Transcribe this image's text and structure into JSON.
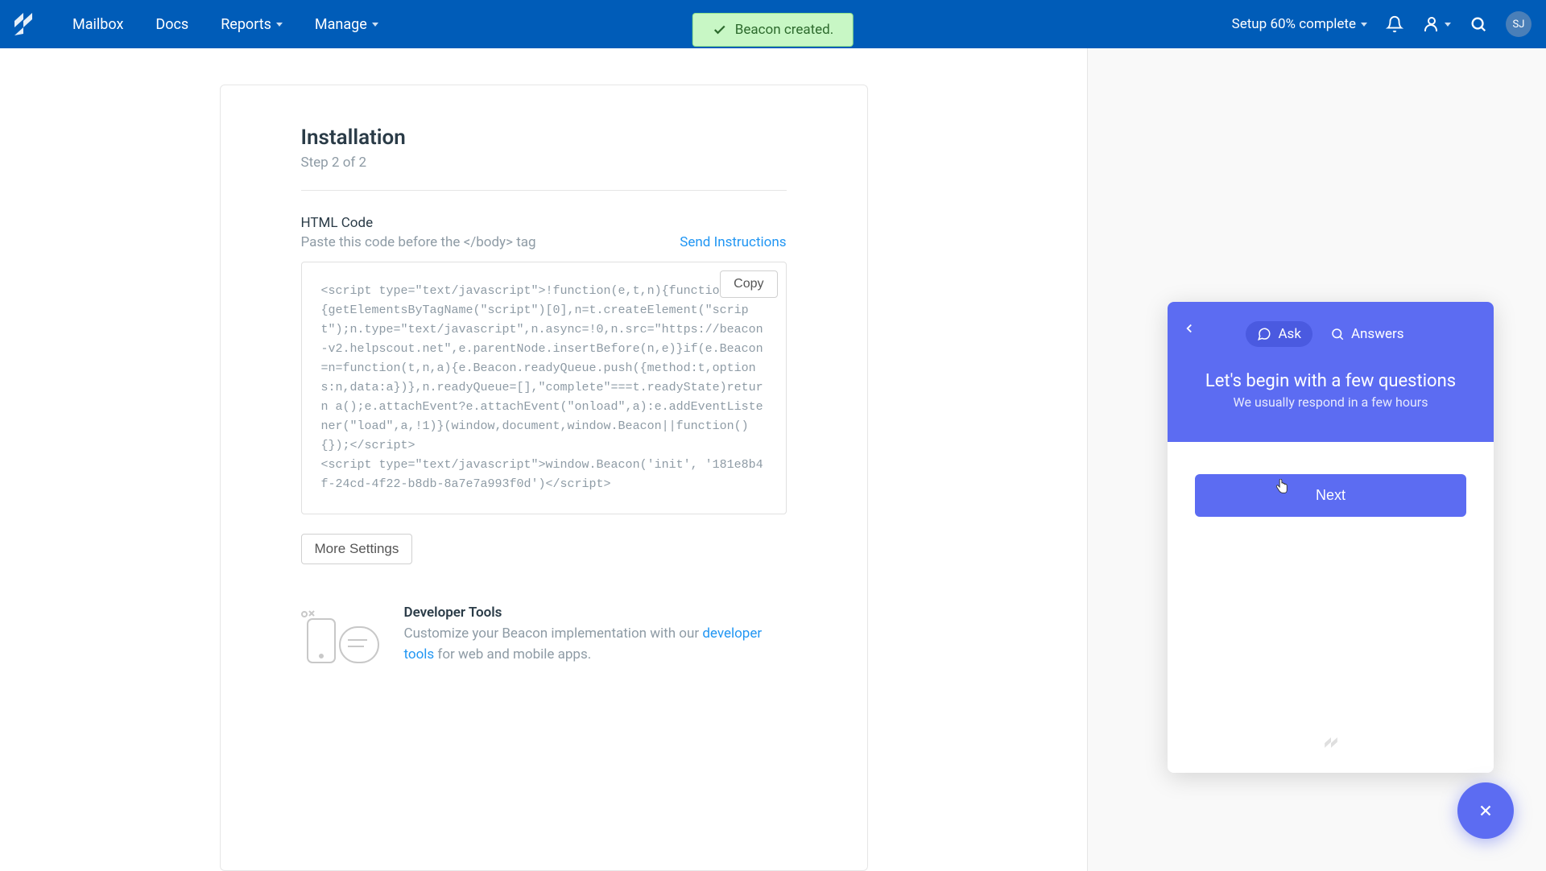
{
  "nav": {
    "items": [
      {
        "label": "Mailbox",
        "has_caret": false
      },
      {
        "label": "Docs",
        "has_caret": false
      },
      {
        "label": "Reports",
        "has_caret": true
      },
      {
        "label": "Manage",
        "has_caret": true
      }
    ],
    "setup_text": "Setup 60% complete",
    "avatar_initials": "SJ"
  },
  "toast": {
    "message": "Beacon created."
  },
  "card": {
    "title": "Installation",
    "step": "Step 2 of 2",
    "html_code_label": "HTML Code",
    "paste_instruction": "Paste this code before the </body> tag",
    "send_instructions": "Send Instructions",
    "code_snippet": "<script type=\"text/javascript\">!function(e,t,n){function a(){getElementsByTagName(\"script\")[0],n=t.createElement(\"script\");n.type=\"text/javascript\",n.async=!0,n.src=\"https://beacon-v2.helpscout.net\",e.parentNode.insertBefore(n,e)}if(e.Beacon=n=function(t,n,a){e.Beacon.readyQueue.push({method:t,options:n,data:a})},n.readyQueue=[],\"complete\"===t.readyState)return a();e.attachEvent?e.attachEvent(\"onload\",a):e.addEventListener(\"load\",a,!1)}(window,document,window.Beacon||function(){});</script>\n<script type=\"text/javascript\">window.Beacon('init', '181e8b4f-24cd-4f22-b8db-8a7e7a993f0d')</script>",
    "copy_label": "Copy",
    "more_settings": "More Settings",
    "dev_title": "Developer Tools",
    "dev_desc_1": "Customize your Beacon implementation with our ",
    "dev_link": "developer tools",
    "dev_desc_2": " for web and mobile apps."
  },
  "beacon": {
    "tab_ask": "Ask",
    "tab_answers": "Answers",
    "title": "Let's begin with a few questions",
    "subtitle": "We usually respond in a few hours",
    "next": "Next"
  },
  "colors": {
    "topbar": "#005cb8",
    "beacon_primary": "#5c6cf2",
    "toast_bg": "#c8f7c5",
    "link": "#2196f3"
  }
}
